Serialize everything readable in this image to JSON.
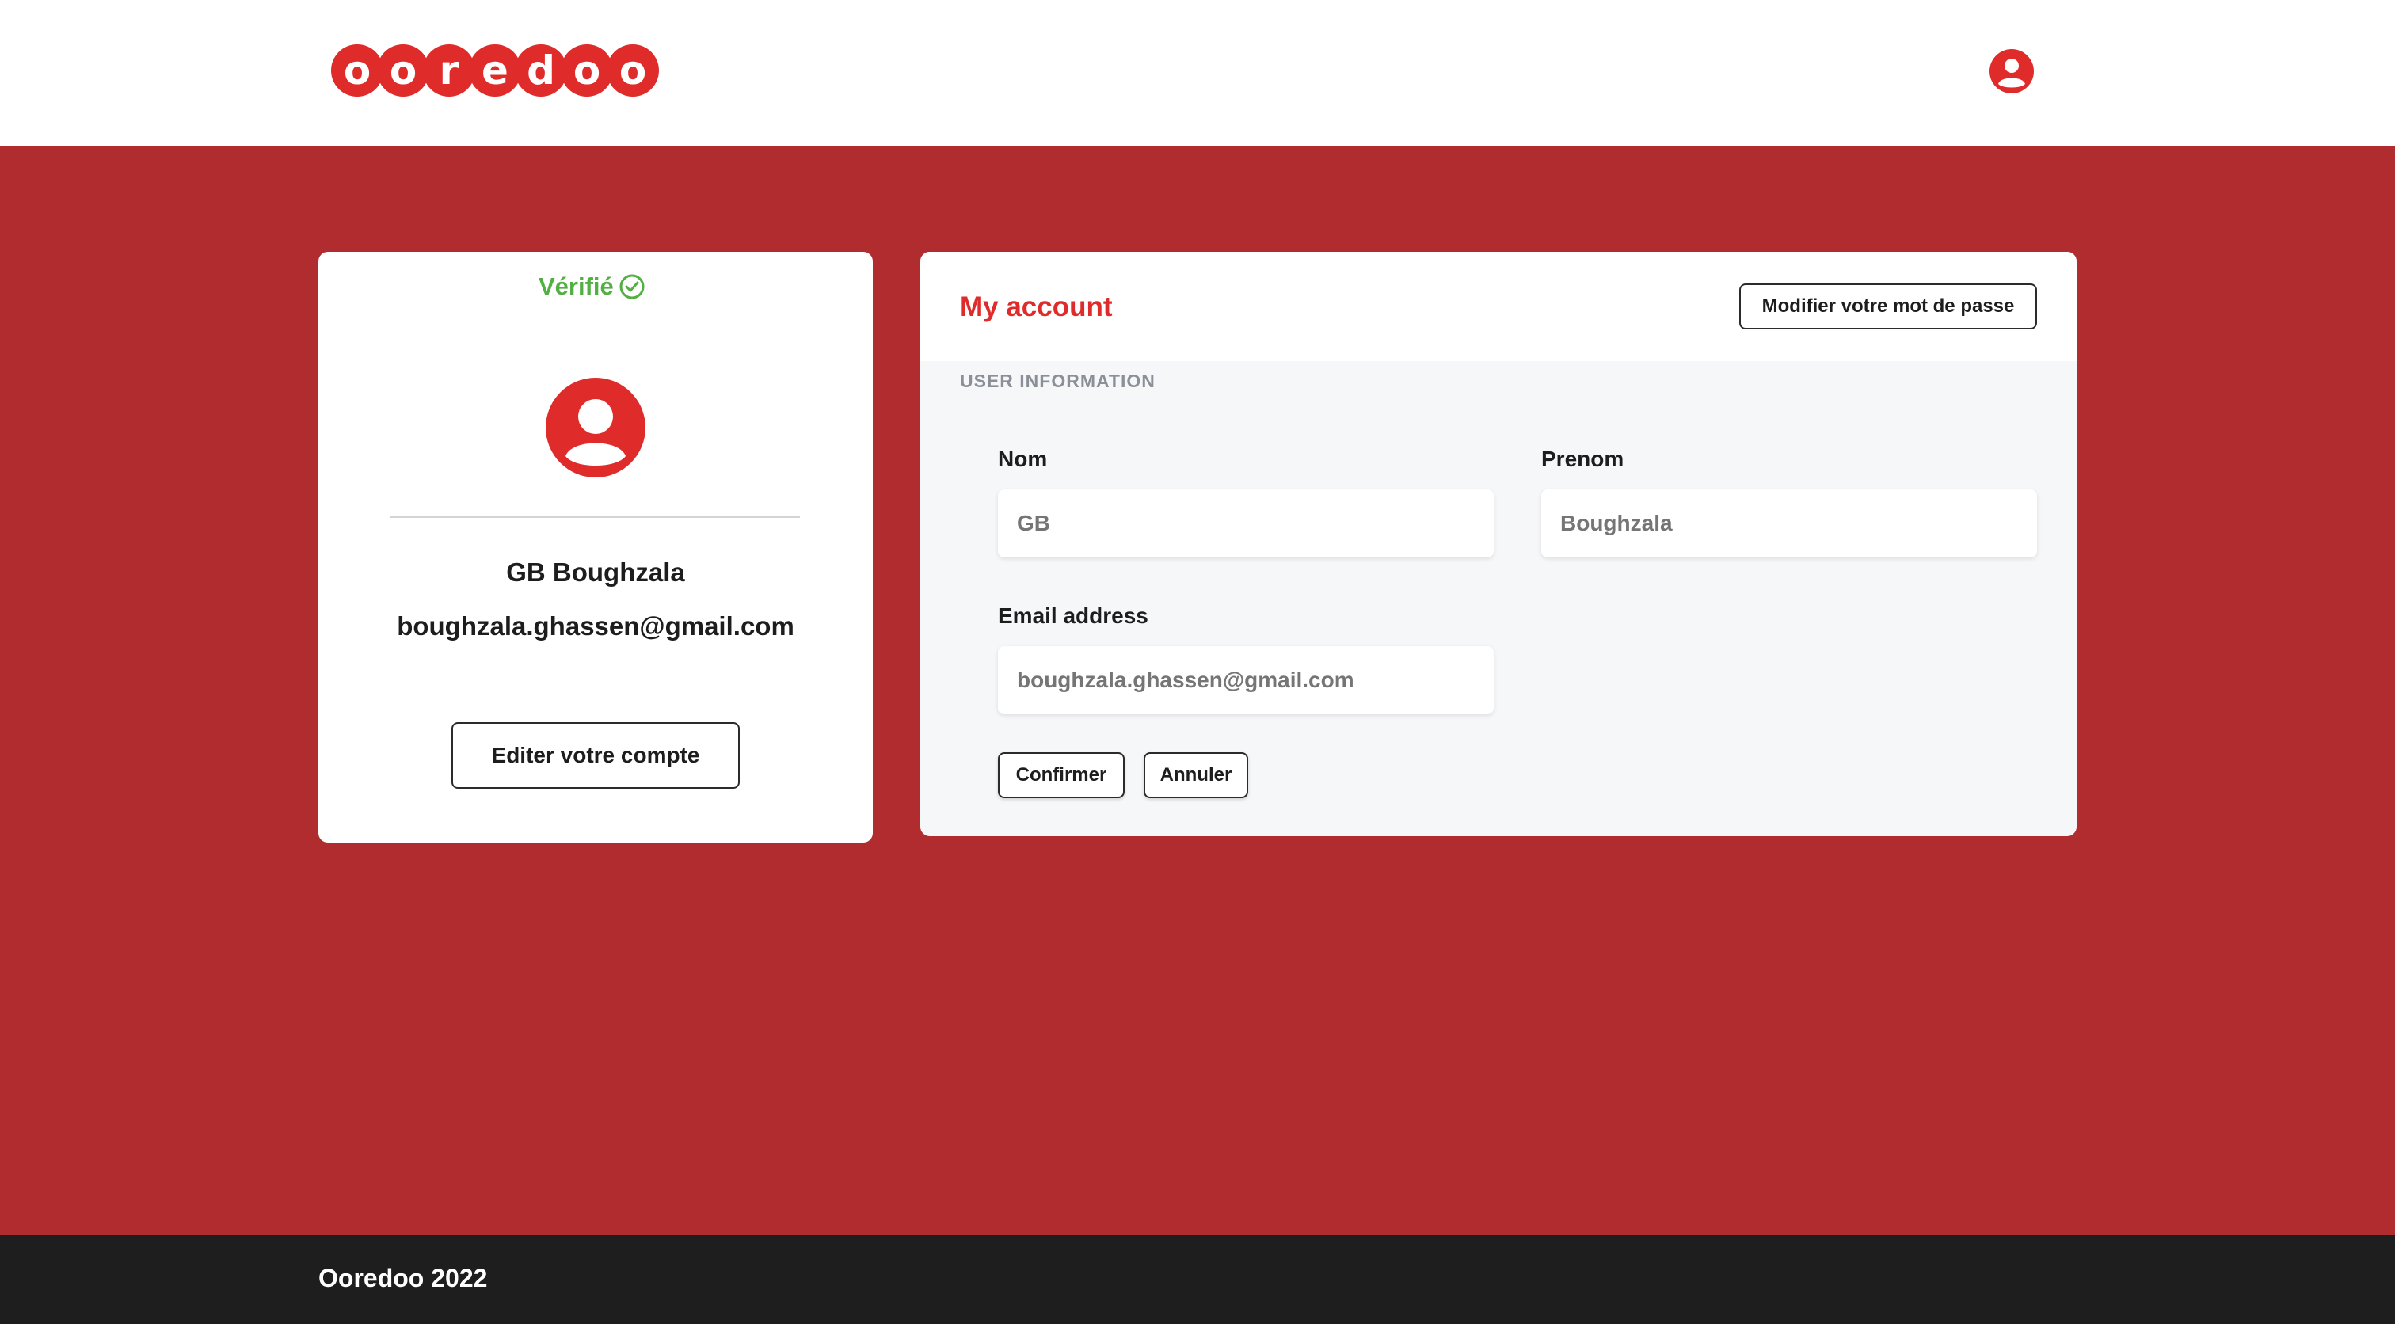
{
  "header": {
    "logo_letters": [
      "o",
      "o",
      "r",
      "e",
      "d",
      "o",
      "o"
    ],
    "logo_alt": "ooredoo",
    "brand_color": "#e02b2b",
    "user_icon": "user-circle-icon"
  },
  "profile": {
    "verified_label": "Vérifié",
    "verified_color": "#52b043",
    "name": "GB Boughzala",
    "email": "boughzala.ghassen@gmail.com",
    "edit_button": "Editer votre compte"
  },
  "account": {
    "title": "My account",
    "change_password_button": "Modifier votre mot de passe",
    "section_label": "USER INFORMATION",
    "fields": {
      "nom": {
        "label": "Nom",
        "placeholder": "GB"
      },
      "prenom": {
        "label": "Prenom",
        "placeholder": "Boughzala"
      },
      "email": {
        "label": "Email address",
        "placeholder": "boughzala.ghassen@gmail.com"
      }
    },
    "confirm_button": "Confirmer",
    "cancel_button": "Annuler"
  },
  "footer": {
    "text": "Ooredoo 2022"
  },
  "colors": {
    "background": "#b12c2e",
    "footer": "#1e1e1f"
  }
}
